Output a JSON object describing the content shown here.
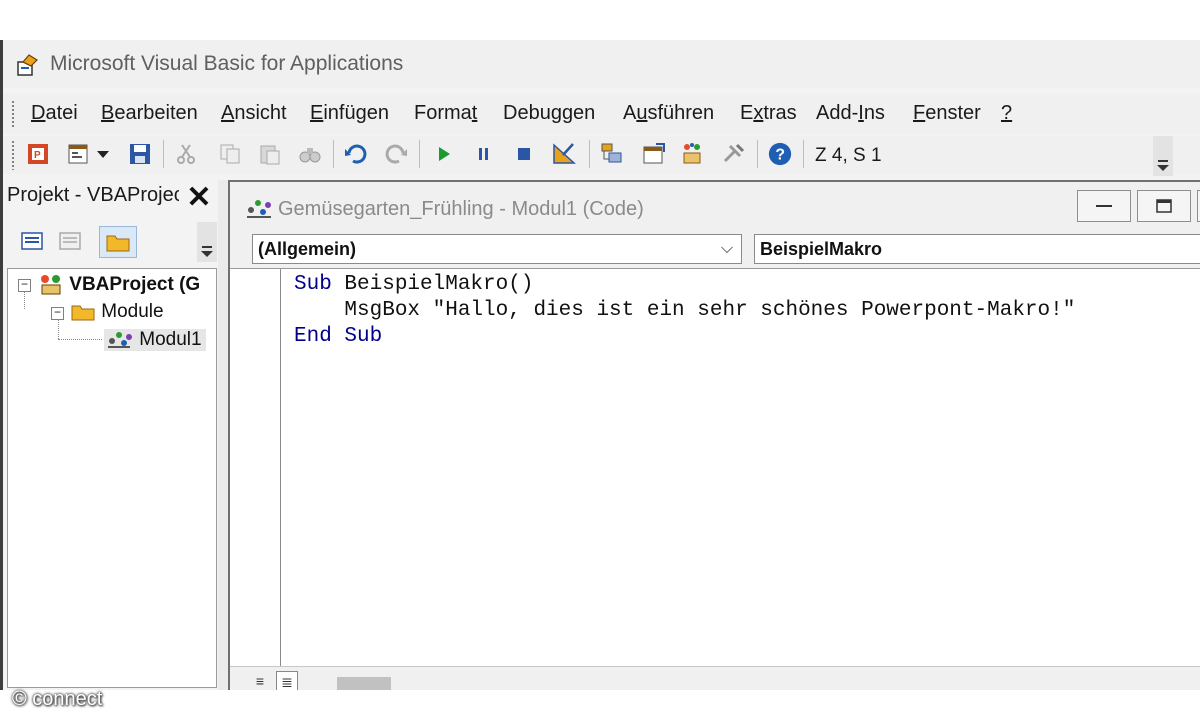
{
  "app": {
    "title": "Microsoft Visual Basic for Applications"
  },
  "menu": {
    "items": [
      {
        "pre": "",
        "ul": "D",
        "post": "atei"
      },
      {
        "pre": "",
        "ul": "B",
        "post": "earbeiten"
      },
      {
        "pre": "",
        "ul": "A",
        "post": "nsicht"
      },
      {
        "pre": "",
        "ul": "E",
        "post": "infügen"
      },
      {
        "pre": "Forma",
        "ul": "t",
        "post": ""
      },
      {
        "pre": "Debu",
        "ul": "g",
        "post": "gen"
      },
      {
        "pre": "A",
        "ul": "u",
        "post": "sführen"
      },
      {
        "pre": "E",
        "ul": "x",
        "post": "tras"
      },
      {
        "pre": "Add-",
        "ul": "I",
        "post": "ns"
      },
      {
        "pre": "",
        "ul": "F",
        "post": "enster"
      },
      {
        "pre": "",
        "ul": "?",
        "post": ""
      }
    ]
  },
  "toolbar": {
    "status": "Z 4, S 1",
    "icons": [
      "powerpoint-icon",
      "insert-userform-icon",
      "dropdown-arrow-icon",
      "save-icon",
      "cut-icon",
      "copy-icon",
      "paste-icon",
      "find-icon",
      "undo-icon",
      "redo-icon",
      "run-icon",
      "break-icon",
      "reset-icon",
      "design-mode-icon",
      "project-explorer-icon",
      "properties-icon",
      "object-browser-icon",
      "toolbox-icon",
      "help-icon"
    ]
  },
  "project": {
    "title": "Projekt - VBAProject",
    "close": "✕",
    "tree": {
      "root": "VBAProject (G",
      "folder": "Module",
      "module": "Modul1"
    }
  },
  "code_window": {
    "title": "Gemüsegarten_Frühling - Modul1 (Code)",
    "object_combo": "(Allgemein)",
    "proc_combo": "BeispielMakro",
    "lines": [
      {
        "kw": "Sub",
        "rest": " BeispielMakro()"
      },
      {
        "kw": "",
        "rest": "    MsgBox \"Hallo, dies ist ein sehr schönes Powerpont-Makro!\""
      },
      {
        "kw": "End Sub",
        "rest": ""
      }
    ]
  },
  "watermark": "© connect",
  "colors": {
    "keyword": "#00008b",
    "run": "#1a9b2f",
    "accent": "#1f5fb3"
  }
}
